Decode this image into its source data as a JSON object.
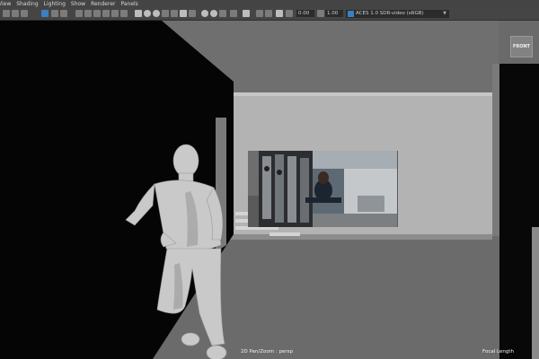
{
  "menu": {
    "items": [
      "View",
      "Shading",
      "Lighting",
      "Show",
      "Renderer",
      "Panels"
    ]
  },
  "toolbar": {
    "field1_value": "0.00",
    "field2_value": "1.00",
    "color_space": "ACES 1.0 SDR-video (sRGB)"
  },
  "viewport": {
    "view_cube_label": "FRONT",
    "camera_label": "2D Pan/Zoom : persp",
    "focal_length_label": "Focal Length"
  },
  "colors": {
    "menu_bg": "#444444",
    "accent": "#3a7fc1",
    "scene_gray": "#6b6b6b",
    "wall_light": "#b3b3b3"
  }
}
